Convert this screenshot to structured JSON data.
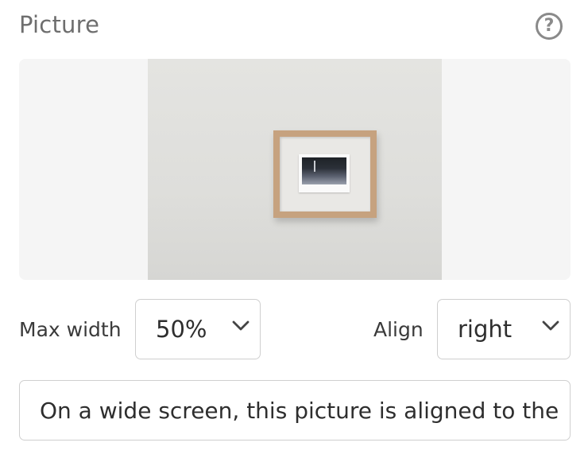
{
  "section": {
    "title": "Picture",
    "help_icon": "question-circle-icon",
    "help_glyph": "?"
  },
  "controls": {
    "max_width": {
      "label": "Max width",
      "value": "50%",
      "icon": "chevron-down-icon"
    },
    "align": {
      "label": "Align",
      "value": "right",
      "icon": "chevron-down-icon"
    }
  },
  "caption": {
    "value": "On a wide screen, this picture is aligned to the"
  }
}
